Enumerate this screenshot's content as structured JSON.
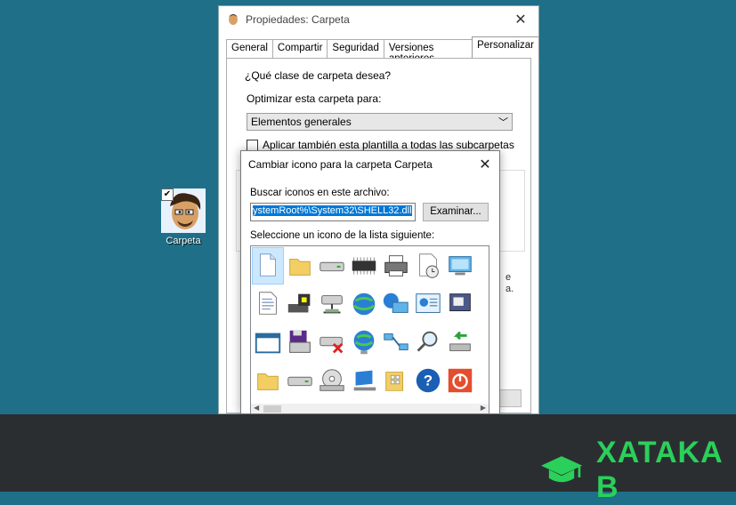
{
  "desktop": {
    "icon_label": "Carpeta"
  },
  "props_window": {
    "title": "Propiedades: Carpeta",
    "tabs": [
      {
        "label": "General"
      },
      {
        "label": "Compartir"
      },
      {
        "label": "Seguridad"
      },
      {
        "label": "Versiones anteriores"
      },
      {
        "label": "Personalizar"
      }
    ],
    "group_label": "¿Qué clase de carpeta desea?",
    "optimize_label": "Optimizar esta carpeta para:",
    "optimize_value": "Elementos generales",
    "apply_label": "Aplicar también esta plantilla a todas las subcarpetas",
    "partial_text_1": "e",
    "partial_text_2": "a."
  },
  "icon_dialog": {
    "title": "Cambiar icono para la carpeta Carpeta",
    "search_label": "Buscar iconos en este archivo:",
    "path_value": "ystemRoot%\\System32\\SHELL32.dll",
    "browse_label": "Examinar...",
    "list_label": "Seleccione un icono de la lista siguiente:",
    "icons": [
      "blank-document-icon",
      "folder-icon",
      "drive-icon",
      "memory-chip-icon",
      "printer-icon",
      "clock-document-icon",
      "display-icon",
      "partial-icon",
      "text-document-icon",
      "hardware-icon",
      "network-drive-icon",
      "globe-icon",
      "network-computer-icon",
      "control-panel-icon",
      "dialog-icon",
      "shortcut-overlay-icon",
      "window-icon",
      "save-disk-icon",
      "delete-drive-icon",
      "web-globe-icon",
      "network-icon",
      "search-icon",
      "backup-arrow-icon",
      "partial-icon",
      "folder-icon",
      "drive-icon",
      "cd-drive-icon",
      "computer-icon",
      "grid-folder-icon",
      "help-icon",
      "power-icon",
      "partial-icon"
    ]
  },
  "banner": {
    "brand_name": "XATAKA B"
  }
}
